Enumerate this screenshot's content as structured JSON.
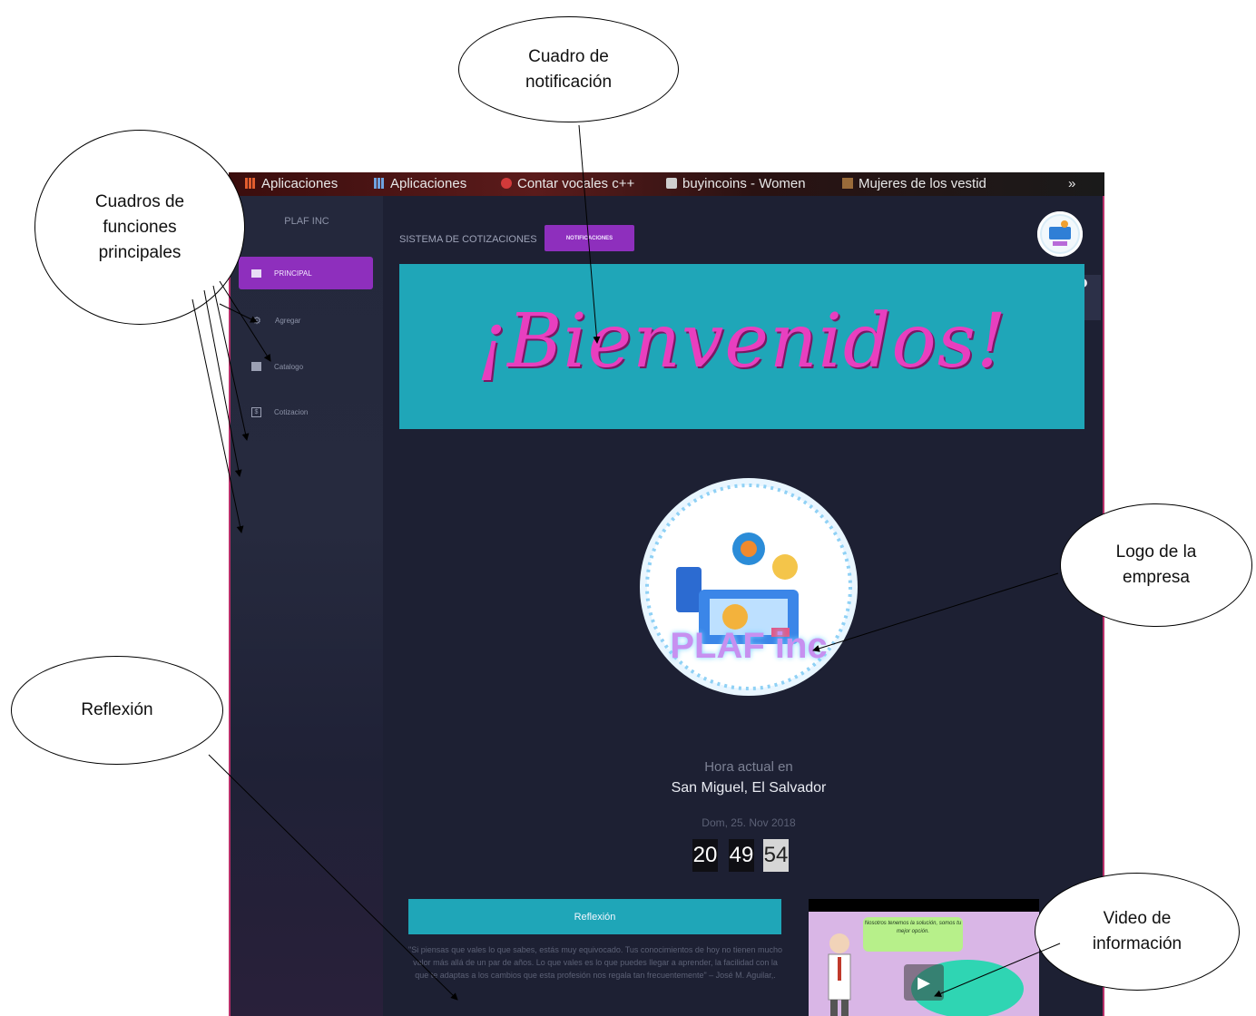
{
  "bookmarks": [
    {
      "label": "Aplicaciones",
      "icon": "apps-grid-icon"
    },
    {
      "label": "Aplicaciones",
      "icon": "apps-grid-icon"
    },
    {
      "label": "Contar vocales c++",
      "icon": "bookmark-icon"
    },
    {
      "label": "buyincoins - Women",
      "icon": "bookmark-icon"
    },
    {
      "label": "Mujeres de los vestid",
      "icon": "bookmark-icon"
    },
    {
      "label": "»",
      "icon": ""
    }
  ],
  "sidebar": {
    "brand": "PLAF INC",
    "items": [
      {
        "label": "PRINCIPAL",
        "icon": "grid-icon",
        "active": true
      },
      {
        "label": "Agregar",
        "icon": "gear-icon",
        "active": false
      },
      {
        "label": "Catalogo",
        "icon": "book-icon",
        "active": false
      },
      {
        "label": "Cotizacion",
        "icon": "dollar-icon",
        "active": false
      }
    ]
  },
  "header": {
    "system_title": "SISTEMA DE COTIZACIONES",
    "notifications_label": "NOTIFICACIONES"
  },
  "banner": {
    "text": "¡Bienvenidos!"
  },
  "logo": {
    "text": "PLAF inc"
  },
  "clock": {
    "label": "Hora actual en",
    "city": "San Miguel, El Salvador",
    "date": "Dom, 25. Nov 2018",
    "hours": "20",
    "minutes": "49",
    "seconds": "54"
  },
  "reflection": {
    "title": "Reflexión",
    "text": "\"Si piensas que vales lo que sabes, estás muy equivocado. Tus conocimientos de hoy no tienen mucho valor más allá de un par de años. Lo que vales es lo que puedes llegar a aprender, la facilidad con la que te adaptas a los cambios que esta profesión nos regala tan frecuentemente\" – José M. Aguilar,."
  },
  "video": {
    "bubble_text": "Nosotros tenemos la solución, somos tu mejor opción."
  },
  "annotations": {
    "notification_box": "Cuadro de notificación",
    "main_functions": "Cuadros de funciones principales",
    "company_logo": "Logo de la empresa",
    "reflection": "Reflexión",
    "info_video": "Video de información"
  },
  "colors": {
    "accent_purple": "#8e2fbd",
    "banner_teal": "#1fa6b8",
    "banner_text_pink": "#e83fbf",
    "app_background": "#1d2033"
  }
}
